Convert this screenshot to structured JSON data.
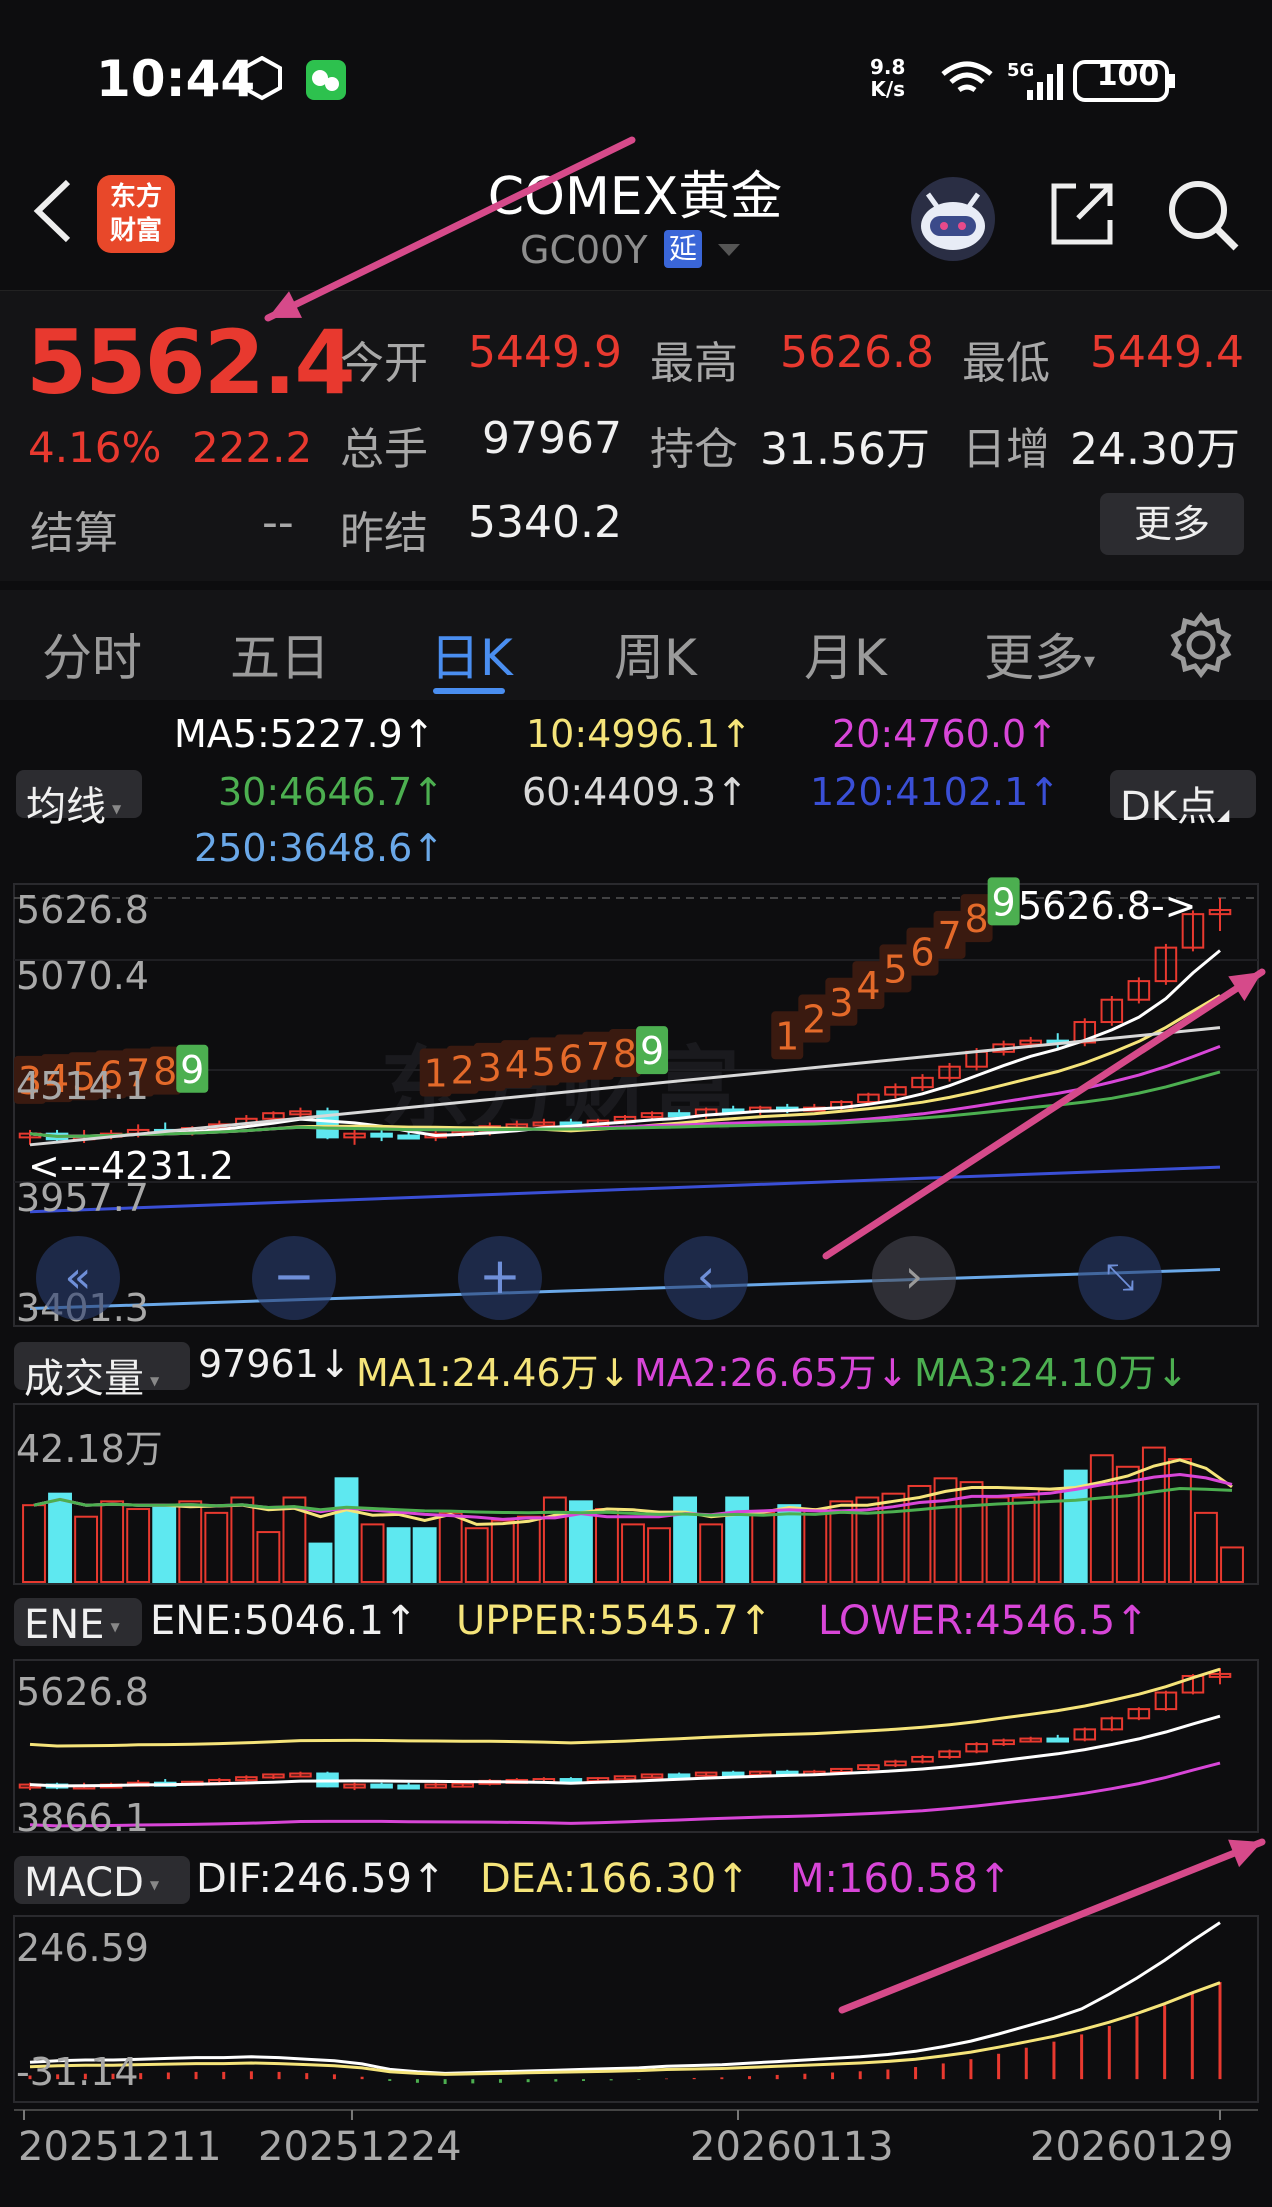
{
  "status_bar": {
    "time": "10:44",
    "net_speed_top": "9.8",
    "net_speed_bottom": "K/s",
    "battery": "100"
  },
  "header": {
    "back_icon": "chevron-left-icon",
    "logo_line1": "东方",
    "logo_line2": "财富",
    "title": "COMEX黄金",
    "code": "GC00Y",
    "delay_badge": "延",
    "robot_icon": "robot-assistant-icon",
    "share_icon": "share-icon",
    "search_icon": "search-icon"
  },
  "quote": {
    "price": "5562.4",
    "change_pct": "4.16%",
    "change_amt": "222.2",
    "open_label": "今开",
    "open": "5449.9",
    "high_label": "最高",
    "high": "5626.8",
    "low_label": "最低",
    "low": "5449.4",
    "volume_label": "总手",
    "volume": "97967",
    "oi_label": "持仓",
    "oi": "31.56万",
    "daily_inc_label": "日增",
    "daily_inc": "24.30万",
    "settle_label": "结算",
    "settle": "--",
    "prev_settle_label": "昨结",
    "prev_settle": "5340.2",
    "more_button": "更多"
  },
  "tabs": {
    "items": [
      "分时",
      "五日",
      "日K",
      "周K",
      "月K",
      "更多"
    ],
    "active": "日K",
    "settings_icon": "gear-icon"
  },
  "ma_legend": {
    "ma5": "MA5:5227.9↑",
    "ma10": "10:4996.1↑",
    "ma20": "20:4760.0↑",
    "ma30": "30:4646.7↑",
    "ma60": "60:4409.3↑",
    "ma120": "120:4102.1↑",
    "ma250": "250:3648.6↑",
    "dropdown": "均线",
    "dk_button": "DK点"
  },
  "colors": {
    "up": "#e8392f",
    "down": "#5ee8f0",
    "ma5": "#ffffff",
    "ma10": "#f5e47a",
    "ma20": "#d846d8",
    "ma30": "#4caf50",
    "ma60": "#d8d8d8",
    "ma120": "#3a4fd6",
    "ma250": "#6aa8e8",
    "td_setup": "#e46a2a",
    "td_nine": "#4caf50",
    "arrow": "#d64a8a"
  },
  "chart_data": [
    {
      "type": "candlestick",
      "title": "日K",
      "y_ticks": [
        "5626.8",
        "5070.4",
        "4514.1",
        "3957.7",
        "3401.3"
      ],
      "high_annotation": "5626.8->",
      "low_annotation": "<---4231.2",
      "ylim": [
        3401.3,
        5626.8
      ],
      "td_labels_1": [
        "3",
        "4",
        "5",
        "6",
        "7",
        "8",
        "9"
      ],
      "td_labels_2": [
        "1",
        "2",
        "3",
        "4",
        "5",
        "6",
        "7",
        "8",
        "9"
      ],
      "td_labels_3": [
        "1",
        "2",
        "3",
        "4",
        "5",
        "6",
        "7",
        "8",
        "9"
      ],
      "candles": [
        {
          "o": 4340,
          "h": 4380,
          "l": 4300,
          "c": 4360
        },
        {
          "o": 4360,
          "h": 4380,
          "l": 4310,
          "c": 4330
        },
        {
          "o": 4330,
          "h": 4380,
          "l": 4310,
          "c": 4350
        },
        {
          "o": 4350,
          "h": 4380,
          "l": 4330,
          "c": 4360
        },
        {
          "o": 4360,
          "h": 4410,
          "l": 4340,
          "c": 4380
        },
        {
          "o": 4380,
          "h": 4420,
          "l": 4350,
          "c": 4370
        },
        {
          "o": 4370,
          "h": 4400,
          "l": 4350,
          "c": 4390
        },
        {
          "o": 4390,
          "h": 4430,
          "l": 4370,
          "c": 4410
        },
        {
          "o": 4410,
          "h": 4460,
          "l": 4390,
          "c": 4440
        },
        {
          "o": 4440,
          "h": 4480,
          "l": 4420,
          "c": 4470
        },
        {
          "o": 4470,
          "h": 4500,
          "l": 4440,
          "c": 4480
        },
        {
          "o": 4480,
          "h": 4500,
          "l": 4330,
          "c": 4340
        },
        {
          "o": 4340,
          "h": 4380,
          "l": 4300,
          "c": 4360
        },
        {
          "o": 4360,
          "h": 4380,
          "l": 4320,
          "c": 4350
        },
        {
          "o": 4350,
          "h": 4380,
          "l": 4330,
          "c": 4340
        },
        {
          "o": 4340,
          "h": 4380,
          "l": 4320,
          "c": 4360
        },
        {
          "o": 4360,
          "h": 4390,
          "l": 4340,
          "c": 4370
        },
        {
          "o": 4370,
          "h": 4420,
          "l": 4350,
          "c": 4400
        },
        {
          "o": 4400,
          "h": 4430,
          "l": 4380,
          "c": 4410
        },
        {
          "o": 4410,
          "h": 4440,
          "l": 4390,
          "c": 4420
        },
        {
          "o": 4420,
          "h": 4440,
          "l": 4390,
          "c": 4400
        },
        {
          "o": 4400,
          "h": 4440,
          "l": 4380,
          "c": 4430
        },
        {
          "o": 4430,
          "h": 4460,
          "l": 4410,
          "c": 4450
        },
        {
          "o": 4450,
          "h": 4480,
          "l": 4430,
          "c": 4470
        },
        {
          "o": 4470,
          "h": 4490,
          "l": 4440,
          "c": 4460
        },
        {
          "o": 4460,
          "h": 4500,
          "l": 4440,
          "c": 4490
        },
        {
          "o": 4490,
          "h": 4510,
          "l": 4470,
          "c": 4480
        },
        {
          "o": 4480,
          "h": 4510,
          "l": 4460,
          "c": 4500
        },
        {
          "o": 4500,
          "h": 4520,
          "l": 4470,
          "c": 4490
        },
        {
          "o": 4490,
          "h": 4520,
          "l": 4480,
          "c": 4500
        },
        {
          "o": 4500,
          "h": 4540,
          "l": 4480,
          "c": 4530
        },
        {
          "o": 4530,
          "h": 4580,
          "l": 4510,
          "c": 4570
        },
        {
          "o": 4570,
          "h": 4630,
          "l": 4550,
          "c": 4610
        },
        {
          "o": 4610,
          "h": 4680,
          "l": 4590,
          "c": 4660
        },
        {
          "o": 4660,
          "h": 4740,
          "l": 4640,
          "c": 4720
        },
        {
          "o": 4720,
          "h": 4820,
          "l": 4700,
          "c": 4800
        },
        {
          "o": 4800,
          "h": 4860,
          "l": 4780,
          "c": 4840
        },
        {
          "o": 4840,
          "h": 4880,
          "l": 4820,
          "c": 4860
        },
        {
          "o": 4860,
          "h": 4900,
          "l": 4820,
          "c": 4850
        },
        {
          "o": 4850,
          "h": 4980,
          "l": 4830,
          "c": 4960
        },
        {
          "o": 4960,
          "h": 5100,
          "l": 4940,
          "c": 5080
        },
        {
          "o": 5080,
          "h": 5200,
          "l": 5060,
          "c": 5180
        },
        {
          "o": 5180,
          "h": 5380,
          "l": 5160,
          "c": 5360
        },
        {
          "o": 5360,
          "h": 5560,
          "l": 5340,
          "c": 5540
        },
        {
          "o": 5540,
          "h": 5626.8,
          "l": 5449.4,
          "c": 5562.4
        }
      ]
    },
    {
      "type": "bar",
      "title": "成交量",
      "legend": {
        "last": "97961↓",
        "ma1": "MA1:24.46万↓",
        "ma2": "MA2:26.65万↓",
        "ma3": "MA3:24.10万↓"
      },
      "y_tick": "42.18万",
      "ylim": [
        0,
        42.18
      ],
      "values": [
        20,
        23,
        17,
        21,
        19,
        20,
        21,
        18,
        22,
        13,
        22,
        10,
        27,
        15,
        14,
        14,
        18,
        14,
        16,
        17,
        22,
        21,
        19,
        15,
        14,
        22,
        15,
        22,
        18,
        20,
        19,
        21,
        22,
        23,
        25,
        27,
        26,
        22,
        22,
        24,
        29,
        33,
        30,
        35,
        32,
        18,
        9
      ]
    },
    {
      "type": "line",
      "title": "ENE",
      "legend": {
        "ene": "ENE:5046.1↑",
        "upper": "UPPER:5545.7↑",
        "lower": "LOWER:4546.5↑"
      },
      "y_ticks": [
        "5626.8",
        "3866.1"
      ],
      "ylim": [
        3866.1,
        5626.8
      ]
    },
    {
      "type": "bar",
      "title": "MACD",
      "legend": {
        "dif": "DIF:246.59↑",
        "dea": "DEA:166.30↑",
        "m": "M:160.58↑"
      },
      "y_ticks": [
        "246.59",
        "-31.14"
      ],
      "ylim": [
        -31.14,
        246.59
      ],
      "m_values": [
        6,
        8,
        9,
        9,
        10,
        11,
        12,
        12,
        13,
        12,
        10,
        8,
        4,
        -3,
        -6,
        -8,
        -7,
        -6,
        -5,
        -4,
        -3,
        -2,
        -1,
        1,
        2,
        3,
        5,
        7,
        9,
        11,
        13,
        16,
        20,
        26,
        33,
        42,
        52,
        62,
        74,
        88,
        104,
        122,
        142,
        160.58
      ]
    }
  ],
  "x_axis": {
    "labels": [
      "20251211",
      "20251224",
      "20260113",
      "20260129"
    ]
  },
  "nav": {
    "first_icon": "double-chevron-left-icon",
    "zoom_out_icon": "minus-icon",
    "zoom_in_icon": "plus-icon",
    "prev_icon": "chevron-left-icon",
    "next_icon": "chevron-right-icon",
    "fullscreen_icon": "expand-icon"
  },
  "watermark": "东方财富"
}
